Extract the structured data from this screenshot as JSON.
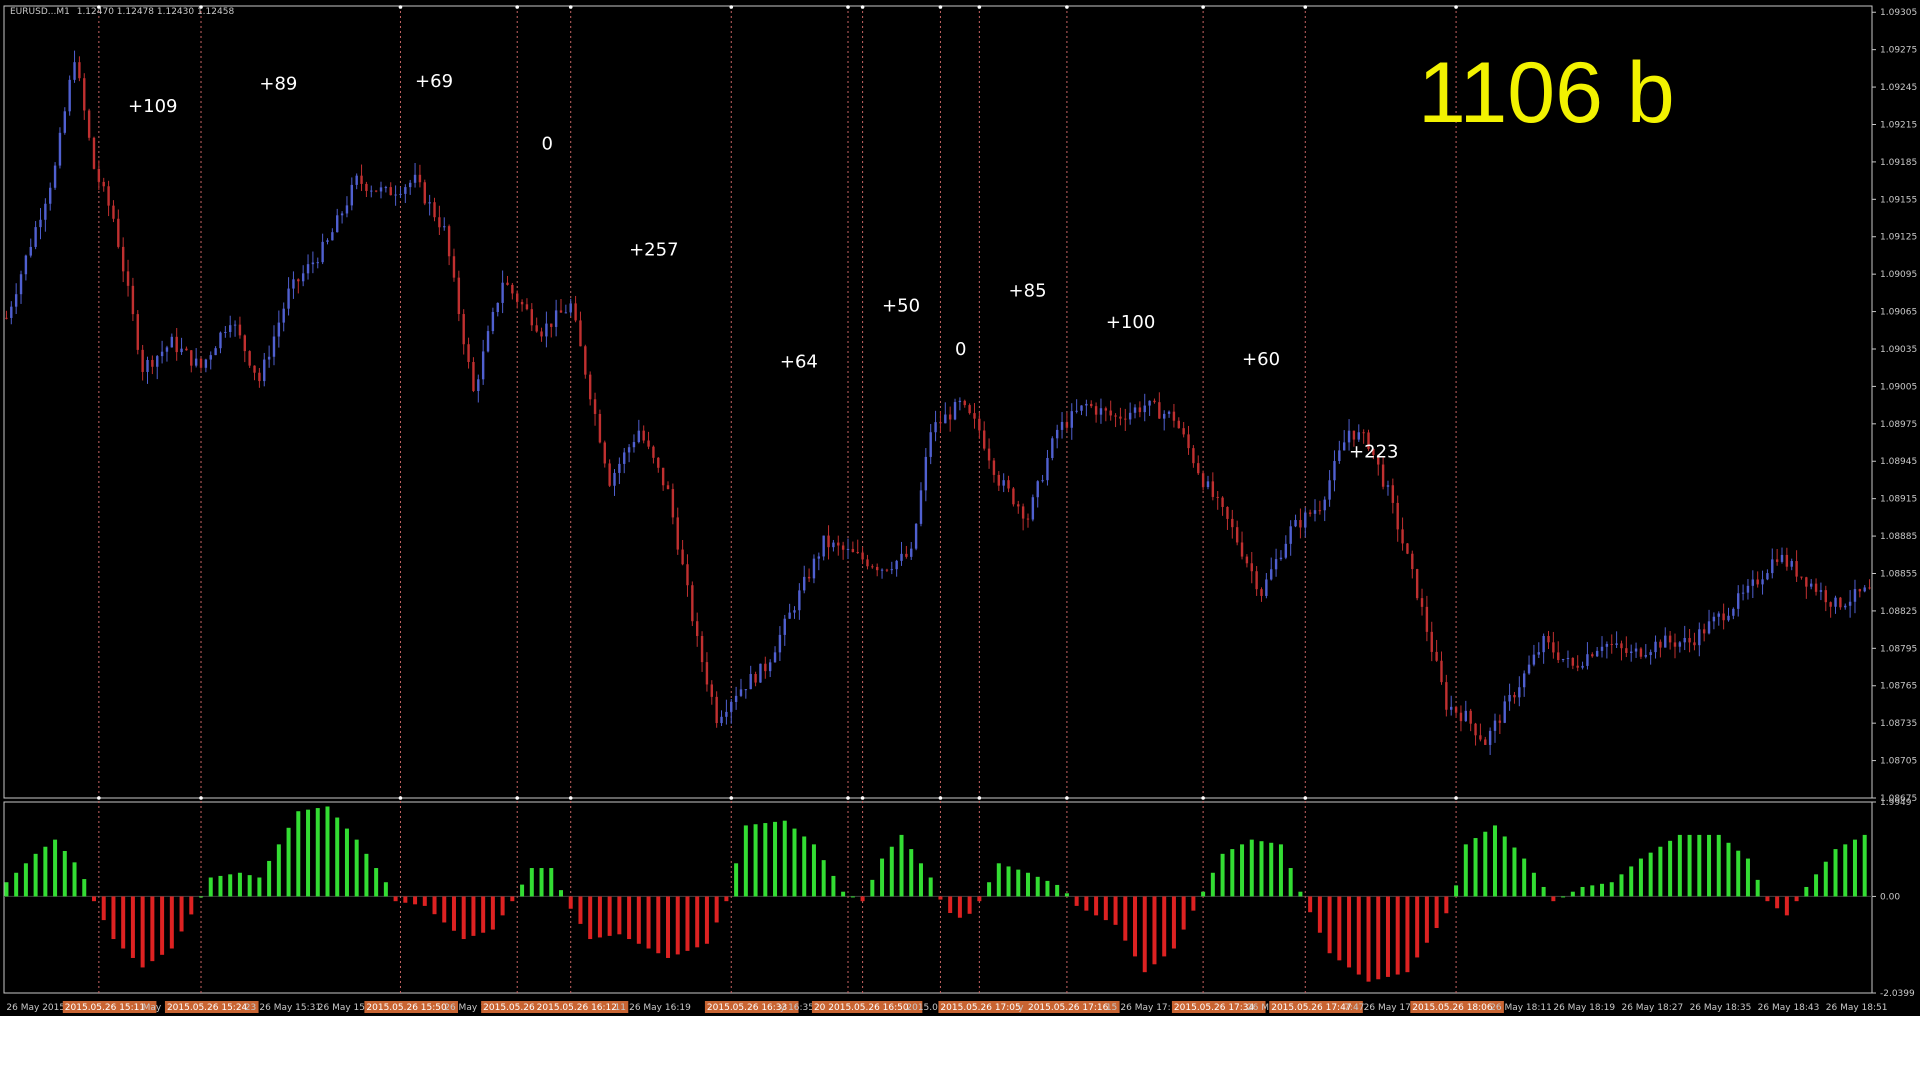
{
  "header": {
    "symbol": "EURUSD...M1",
    "ohlc": "1.12470 1.12478 1.12430 1.12458"
  },
  "big_label": "1106 b",
  "colors": {
    "background": "#000000",
    "frame": "#c8c8c8",
    "bull": "#5060d0",
    "bear": "#c03030",
    "osc_up": "#33dd33",
    "osc_down": "#dd2222",
    "marker_line": "#c86464",
    "x_marker_bg": "#c86432",
    "big_label": "#f2f200",
    "annotation": "#ffffff"
  },
  "chart_data": [
    {
      "type": "candlestick",
      "title": "",
      "ylim": [
        1.08675,
        1.0931
      ],
      "y_ticks": [
        "1.09305",
        "1.09275",
        "1.09245",
        "1.09215",
        "1.09185",
        "1.09155",
        "1.09125",
        "1.09095",
        "1.09065",
        "1.09035",
        "1.09005",
        "1.08975",
        "1.08945",
        "1.08915",
        "1.08885",
        "1.08855",
        "1.08825",
        "1.08795",
        "1.08765",
        "1.08735",
        "1.08705",
        "1.08675"
      ],
      "close_path": [
        {
          "bar": 0,
          "price": 1.0906
        },
        {
          "bar": 10,
          "price": 1.0918
        },
        {
          "bar": 14,
          "price": 1.0927
        },
        {
          "bar": 18,
          "price": 1.0918
        },
        {
          "bar": 22,
          "price": 1.0914
        },
        {
          "bar": 28,
          "price": 1.0902
        },
        {
          "bar": 34,
          "price": 1.0904
        },
        {
          "bar": 40,
          "price": 1.0902
        },
        {
          "bar": 46,
          "price": 1.0906
        },
        {
          "bar": 52,
          "price": 1.0901
        },
        {
          "bar": 58,
          "price": 1.0908
        },
        {
          "bar": 66,
          "price": 1.0912
        },
        {
          "bar": 72,
          "price": 1.0917
        },
        {
          "bar": 78,
          "price": 1.0916
        },
        {
          "bar": 84,
          "price": 1.0917
        },
        {
          "bar": 90,
          "price": 1.0913
        },
        {
          "bar": 96,
          "price": 1.09
        },
        {
          "bar": 102,
          "price": 1.0909
        },
        {
          "bar": 110,
          "price": 1.0905
        },
        {
          "bar": 116,
          "price": 1.0907
        },
        {
          "bar": 120,
          "price": 1.09
        },
        {
          "bar": 124,
          "price": 1.0893
        },
        {
          "bar": 130,
          "price": 1.0897
        },
        {
          "bar": 136,
          "price": 1.0892
        },
        {
          "bar": 142,
          "price": 1.088
        },
        {
          "bar": 146,
          "price": 1.0874
        },
        {
          "bar": 150,
          "price": 1.0876
        },
        {
          "bar": 156,
          "price": 1.0878
        },
        {
          "bar": 162,
          "price": 1.0883
        },
        {
          "bar": 168,
          "price": 1.0888
        },
        {
          "bar": 174,
          "price": 1.0887
        },
        {
          "bar": 180,
          "price": 1.0886
        },
        {
          "bar": 186,
          "price": 1.0887
        },
        {
          "bar": 190,
          "price": 1.0897
        },
        {
          "bar": 196,
          "price": 1.0899
        },
        {
          "bar": 200,
          "price": 1.0897
        },
        {
          "bar": 204,
          "price": 1.0893
        },
        {
          "bar": 210,
          "price": 1.089
        },
        {
          "bar": 216,
          "price": 1.0897
        },
        {
          "bar": 222,
          "price": 1.0899
        },
        {
          "bar": 228,
          "price": 1.0898
        },
        {
          "bar": 234,
          "price": 1.0899
        },
        {
          "bar": 240,
          "price": 1.0898
        },
        {
          "bar": 246,
          "price": 1.0893
        },
        {
          "bar": 252,
          "price": 1.0889
        },
        {
          "bar": 258,
          "price": 1.0884
        },
        {
          "bar": 264,
          "price": 1.0889
        },
        {
          "bar": 270,
          "price": 1.0891
        },
        {
          "bar": 276,
          "price": 1.0897
        },
        {
          "bar": 280,
          "price": 1.0896
        },
        {
          "bar": 284,
          "price": 1.0892
        },
        {
          "bar": 290,
          "price": 1.0884
        },
        {
          "bar": 296,
          "price": 1.0875
        },
        {
          "bar": 300,
          "price": 1.0874
        },
        {
          "bar": 304,
          "price": 1.0872
        },
        {
          "bar": 310,
          "price": 1.0876
        },
        {
          "bar": 316,
          "price": 1.088
        },
        {
          "bar": 322,
          "price": 1.0878
        },
        {
          "bar": 328,
          "price": 1.088
        },
        {
          "bar": 334,
          "price": 1.0879
        },
        {
          "bar": 340,
          "price": 1.088
        },
        {
          "bar": 346,
          "price": 1.088
        },
        {
          "bar": 352,
          "price": 1.0882
        },
        {
          "bar": 358,
          "price": 1.0884
        },
        {
          "bar": 364,
          "price": 1.0887
        },
        {
          "bar": 370,
          "price": 1.0885
        },
        {
          "bar": 376,
          "price": 1.0883
        },
        {
          "bar": 382,
          "price": 1.0884
        }
      ],
      "annotations": [
        {
          "text": "+109",
          "bar": 25,
          "price": 1.09225
        },
        {
          "text": "+89",
          "bar": 52,
          "price": 1.09243
        },
        {
          "text": "+69",
          "bar": 84,
          "price": 1.09245
        },
        {
          "text": "0",
          "bar": 110,
          "price": 1.09195
        },
        {
          "text": "+257",
          "bar": 128,
          "price": 1.0911
        },
        {
          "text": "+64",
          "bar": 159,
          "price": 1.0902
        },
        {
          "text": "+50",
          "bar": 180,
          "price": 1.09065
        },
        {
          "text": "0",
          "bar": 195,
          "price": 1.0903
        },
        {
          "text": "+85",
          "bar": 206,
          "price": 1.09077
        },
        {
          "text": "+100",
          "bar": 226,
          "price": 1.09052
        },
        {
          "text": "+60",
          "bar": 254,
          "price": 1.09022
        },
        {
          "text": "+223",
          "bar": 276,
          "price": 1.08948
        }
      ],
      "marker_bars": [
        19,
        40,
        81,
        105,
        116,
        149,
        173,
        176,
        192,
        200,
        218,
        246,
        267,
        298
      ]
    },
    {
      "type": "bar",
      "title": "",
      "ylim": [
        -2.0399,
        1.9949
      ],
      "y_ticks": [
        "1.9949",
        "0.00",
        "-2.0399"
      ],
      "osc_path": [
        {
          "bar": 0,
          "value": 0.3
        },
        {
          "bar": 6,
          "value": 0.9
        },
        {
          "bar": 10,
          "value": 1.2
        },
        {
          "bar": 15,
          "value": 0.6
        },
        {
          "bar": 18,
          "value": -0.1
        },
        {
          "bar": 22,
          "value": -0.9
        },
        {
          "bar": 28,
          "value": -1.5
        },
        {
          "bar": 34,
          "value": -1.1
        },
        {
          "bar": 39,
          "value": -0.2
        },
        {
          "bar": 42,
          "value": 0.4
        },
        {
          "bar": 48,
          "value": 0.5
        },
        {
          "bar": 52,
          "value": 0.4
        },
        {
          "bar": 60,
          "value": 1.8
        },
        {
          "bar": 66,
          "value": 1.9
        },
        {
          "bar": 72,
          "value": 1.2
        },
        {
          "bar": 78,
          "value": 0.3
        },
        {
          "bar": 80,
          "value": -0.1
        },
        {
          "bar": 86,
          "value": -0.2
        },
        {
          "bar": 94,
          "value": -0.9
        },
        {
          "bar": 100,
          "value": -0.7
        },
        {
          "bar": 104,
          "value": -0.1
        },
        {
          "bar": 108,
          "value": 0.6
        },
        {
          "bar": 112,
          "value": 0.6
        },
        {
          "bar": 115,
          "value": -0.1
        },
        {
          "bar": 120,
          "value": -0.9
        },
        {
          "bar": 126,
          "value": -0.8
        },
        {
          "bar": 136,
          "value": -1.3
        },
        {
          "bar": 144,
          "value": -1.0
        },
        {
          "bar": 148,
          "value": -0.1
        },
        {
          "bar": 152,
          "value": 1.5
        },
        {
          "bar": 160,
          "value": 1.6
        },
        {
          "bar": 166,
          "value": 1.1
        },
        {
          "bar": 172,
          "value": 0.1
        },
        {
          "bar": 176,
          "value": -0.1
        },
        {
          "bar": 180,
          "value": 0.8
        },
        {
          "bar": 184,
          "value": 1.3
        },
        {
          "bar": 190,
          "value": 0.4
        },
        {
          "bar": 193,
          "value": -0.3
        },
        {
          "bar": 197,
          "value": -0.5
        },
        {
          "bar": 200,
          "value": -0.1
        },
        {
          "bar": 204,
          "value": 0.7
        },
        {
          "bar": 210,
          "value": 0.5
        },
        {
          "bar": 217,
          "value": 0.2
        },
        {
          "bar": 220,
          "value": -0.2
        },
        {
          "bar": 228,
          "value": -0.6
        },
        {
          "bar": 234,
          "value": -1.6
        },
        {
          "bar": 240,
          "value": -1.1
        },
        {
          "bar": 245,
          "value": -0.1
        },
        {
          "bar": 250,
          "value": 0.9
        },
        {
          "bar": 256,
          "value": 1.2
        },
        {
          "bar": 262,
          "value": 1.1
        },
        {
          "bar": 266,
          "value": 0.1
        },
        {
          "bar": 272,
          "value": -1.2
        },
        {
          "bar": 280,
          "value": -1.8
        },
        {
          "bar": 288,
          "value": -1.6
        },
        {
          "bar": 297,
          "value": -0.2
        },
        {
          "bar": 300,
          "value": 1.1
        },
        {
          "bar": 306,
          "value": 1.5
        },
        {
          "bar": 312,
          "value": 0.8
        },
        {
          "bar": 318,
          "value": -0.1
        },
        {
          "bar": 324,
          "value": 0.2
        },
        {
          "bar": 330,
          "value": 0.3
        },
        {
          "bar": 336,
          "value": 0.8
        },
        {
          "bar": 344,
          "value": 1.3
        },
        {
          "bar": 352,
          "value": 1.3
        },
        {
          "bar": 358,
          "value": 0.8
        },
        {
          "bar": 362,
          "value": -0.1
        },
        {
          "bar": 366,
          "value": -0.4
        },
        {
          "bar": 370,
          "value": 0.2
        },
        {
          "bar": 376,
          "value": 1.0
        },
        {
          "bar": 382,
          "value": 1.3
        }
      ]
    }
  ],
  "x_labels": [
    {
      "text": "26 May 2015",
      "bar": 0,
      "marked": false
    },
    {
      "text": "2015.05.26 15:11",
      "bar": 12,
      "marked": true
    },
    {
      "text": "May",
      "bar": 28,
      "marked": false
    },
    {
      "text": "2015.05.26 15:24",
      "bar": 33,
      "marked": true
    },
    {
      "text": "23",
      "bar": 49,
      "marked": false
    },
    {
      "text": "26 May 15:31",
      "bar": 52,
      "marked": false
    },
    {
      "text": "26 May 15:",
      "bar": 64,
      "marked": false
    },
    {
      "text": "2015.05.26 15:50",
      "bar": 74,
      "marked": true
    },
    {
      "text": "26 May 1",
      "bar": 90,
      "marked": false
    },
    {
      "text": "2015.05.26 1",
      "bar": 98,
      "marked": true
    },
    {
      "text": "2015.05.26 16:12",
      "bar": 109,
      "marked": true
    },
    {
      "text": "11",
      "bar": 125,
      "marked": false
    },
    {
      "text": "26 May 16:19",
      "bar": 128,
      "marked": false
    },
    {
      "text": "2015.05.26 16:33",
      "bar": 144,
      "marked": true
    },
    {
      "text": "y 16:35",
      "bar": 159,
      "marked": false
    },
    {
      "text": "20 2015.05.26 16:50",
      "bar": 166,
      "marked": true
    },
    {
      "text": "2015.05.",
      "bar": 185,
      "marked": false
    },
    {
      "text": "2015.05.26 17:05",
      "bar": 192,
      "marked": true
    },
    {
      "text": "y",
      "bar": 208,
      "marked": false
    },
    {
      "text": "2015.05.26 17:16",
      "bar": 210,
      "marked": true
    },
    {
      "text": "15",
      "bar": 226,
      "marked": false
    },
    {
      "text": "26 May 17:",
      "bar": 229,
      "marked": false
    },
    {
      "text": "2015.05.26 17:34",
      "bar": 240,
      "marked": true
    },
    {
      "text": "26 M",
      "bar": 255,
      "marked": false
    },
    {
      "text": "2015.05.26 17:47",
      "bar": 260,
      "marked": true
    },
    {
      "text": "7:47",
      "bar": 275,
      "marked": false
    },
    {
      "text": "26 May 17:",
      "bar": 279,
      "marked": false
    },
    {
      "text": "2015.05.26 18:06",
      "bar": 289,
      "marked": true
    },
    {
      "text": "26 May 18:11",
      "bar": 305,
      "marked": false
    },
    {
      "text": "26 May 18:19",
      "bar": 318,
      "marked": false
    },
    {
      "text": "26 May 18:27",
      "bar": 332,
      "marked": false
    },
    {
      "text": "26 May 18:35",
      "bar": 346,
      "marked": false
    },
    {
      "text": "26 May 18:43",
      "bar": 360,
      "marked": false
    },
    {
      "text": "26 May 18:51",
      "bar": 374,
      "marked": false
    }
  ]
}
